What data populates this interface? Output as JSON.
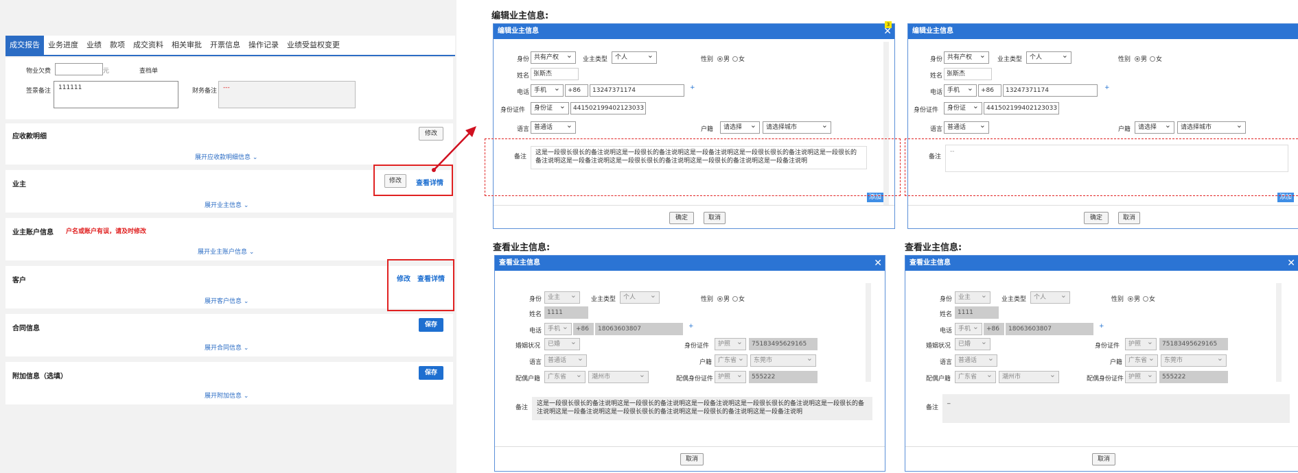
{
  "left": {
    "tabs": [
      "成交报告",
      "业务进度",
      "业绩",
      "款项",
      "成交资料",
      "相关审批",
      "开票信息",
      "操作记录",
      "业绩受益权变更"
    ],
    "form": {
      "property_fee_label": "物业欠费",
      "unit": "元",
      "check_label": "查档单",
      "sign_note_label": "签景备注",
      "sign_note_value": "111111",
      "finance_note_label": "财务备注",
      "finance_note_value": "---"
    },
    "sections": {
      "receivable": {
        "title": "应收款明细",
        "edit": "修改",
        "expand": "展开应收款明细信息"
      },
      "owner": {
        "title": "业主",
        "edit": "修改",
        "detail": "查看详情",
        "expand": "展开业主信息"
      },
      "account": {
        "title": "业主账户信息",
        "warning": "户名或账户有误，请及时修改",
        "expand": "展开业主账户信息"
      },
      "customer": {
        "title": "客户",
        "edit": "修改",
        "detail": "查看详情",
        "expand": "展开客户信息"
      },
      "contract": {
        "title": "合同信息",
        "save": "保存",
        "expand": "展开合同信息"
      },
      "extra": {
        "title": "附加信息（选填）",
        "save": "保存",
        "expand": "展开附加信息"
      }
    }
  },
  "headings": {
    "edit": "编辑业主信息:",
    "view": "查看业主信息:"
  },
  "edit_dialog": {
    "title": "编辑业主信息",
    "badge": "3",
    "identity_label": "身份",
    "identity": "共有产权",
    "owner_type_label": "业主类型",
    "owner_type": "个人",
    "gender_label": "性别",
    "male": "男",
    "female": "女",
    "name_label": "姓名",
    "name": "张斯杰",
    "phone_label": "电话",
    "phone_type": "手机",
    "area_code": "+86",
    "phone": "13247371174",
    "plus": "+",
    "id_label": "身份证件",
    "id_type": "身份证",
    "id_number": "441502199402123033",
    "language_label": "语言",
    "language": "普通话",
    "household_label": "户籍",
    "province": "请选择",
    "city": "请选择城市",
    "note_label": "备注",
    "note_text": "这是一段很长很长的备注说明这是一段很长的备注说明这是一段备注说明这是一段很长很长的备注说明这是一段很长的备注说明这是一段备注说明这是一段很长很长的备注说明这是一段很长的备注说明这是一段备注说明",
    "note_empty": "--",
    "add": "添加",
    "confirm": "确定",
    "cancel": "取消"
  },
  "view_dialog": {
    "title": "查看业主信息",
    "identity_label": "身份",
    "identity": "业主",
    "owner_type_label": "业主类型",
    "owner_type": "个人",
    "gender_label": "性别",
    "male": "男",
    "female": "女",
    "name_label": "姓名",
    "name": "1111",
    "phone_label": "电话",
    "phone_type": "手机",
    "area_code": "+86",
    "phone": "18063603807",
    "plus": "+",
    "marital_label": "婚姻状况",
    "marital": "已婚",
    "id_label": "身份证件",
    "id_type": "护照",
    "id_number": "75183495629165",
    "language_label": "语言",
    "language": "普通话",
    "household_label": "户籍",
    "province": "广东省",
    "city": "东莞市",
    "spouse_household_label": "配偶户籍",
    "spouse_province": "广东省",
    "spouse_city": "潮州市",
    "spouse_id_label": "配偶身份证件",
    "spouse_id_type": "护照",
    "spouse_id_number": "555222",
    "note_label": "备注",
    "note_text": "这是一段很长很长的备注说明这是一段很长的备注说明这是一段备注说明这是一段很长很长的备注说明这是一段很长的备注说明这是一段备注说明这是一段很长很长的备注说明这是一段很长的备注说明这是一段备注说明",
    "note_empty": "_",
    "cancel": "取消"
  }
}
